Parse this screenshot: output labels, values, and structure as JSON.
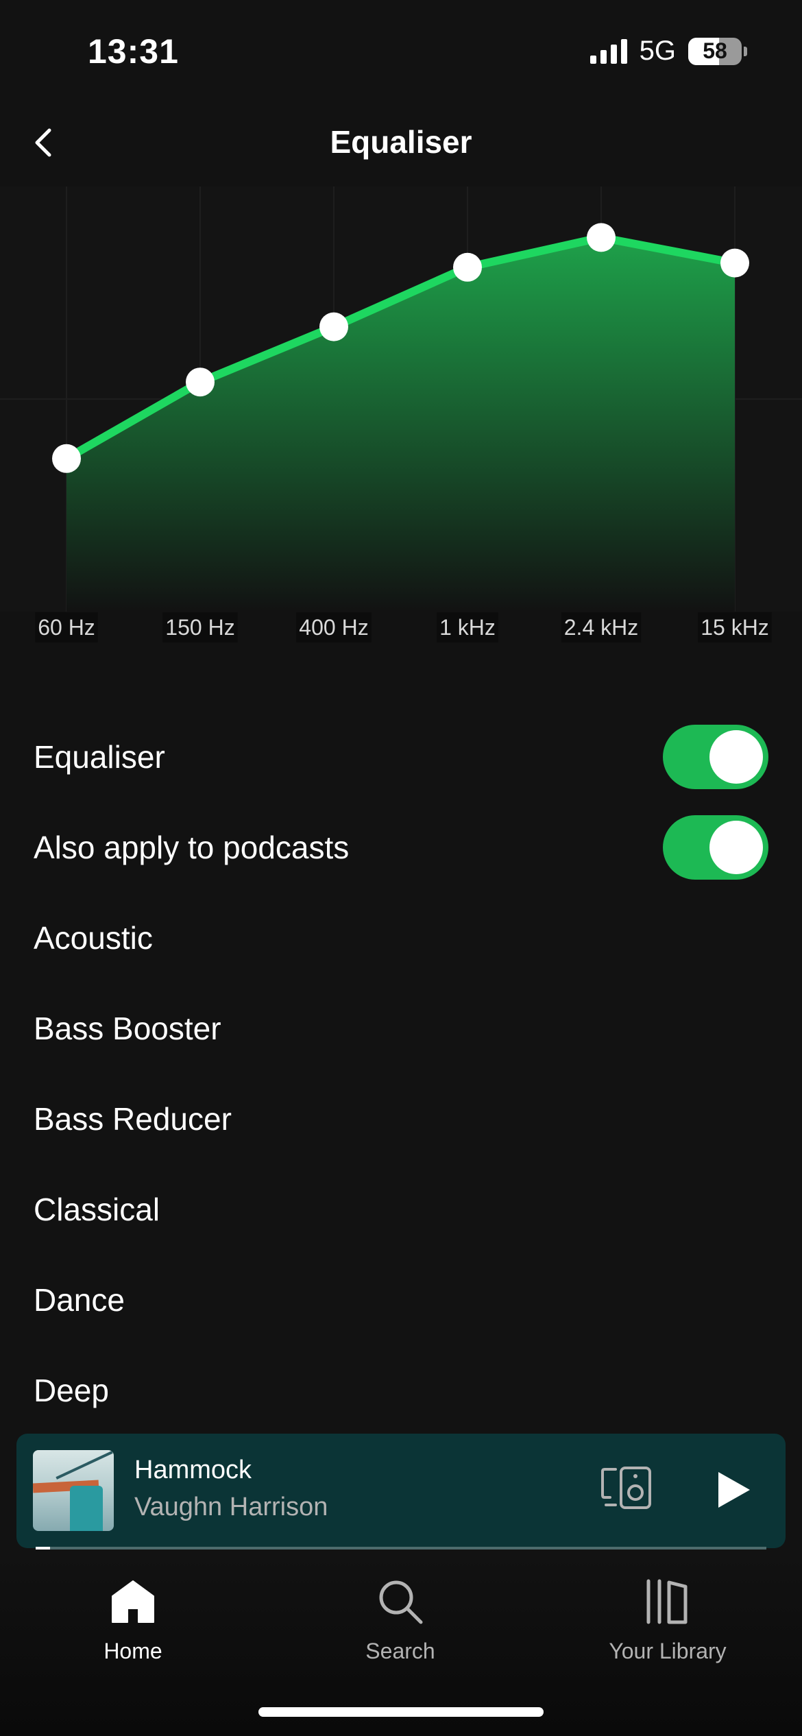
{
  "status_bar": {
    "time": "13:31",
    "network": "5G",
    "battery": "58",
    "battery_level": 0.58
  },
  "header": {
    "title": "Equaliser",
    "back_icon": "chevron-left-icon"
  },
  "equaliser_chart": {
    "bands": [
      "60 Hz",
      "150 Hz",
      "400 Hz",
      "1 kHz",
      "2.4 kHz",
      "15 kHz"
    ],
    "levels": [
      0.36,
      0.54,
      0.67,
      0.81,
      0.88,
      0.82
    ],
    "colors": {
      "line": "#1ed760",
      "fill_top": "#1ea14a",
      "fill_bottom": "#121212",
      "handle": "#ffffff"
    }
  },
  "settings": {
    "equaliser_label": "Equaliser",
    "equaliser_on": true,
    "podcasts_label": "Also apply to podcasts",
    "podcasts_on": true
  },
  "presets": [
    "Acoustic",
    "Bass Booster",
    "Bass Reducer",
    "Classical",
    "Dance",
    "Deep"
  ],
  "mini_player": {
    "song": "Hammock",
    "artist": "Vaughn Harrison",
    "progress": 0.02,
    "device_icon": "connect-device-icon",
    "play_icon": "play-icon"
  },
  "nav": {
    "home": "Home",
    "search": "Search",
    "library": "Your Library"
  },
  "colors": {
    "accent": "#1db954",
    "background": "#121212",
    "player_bg": "#0b3436"
  }
}
